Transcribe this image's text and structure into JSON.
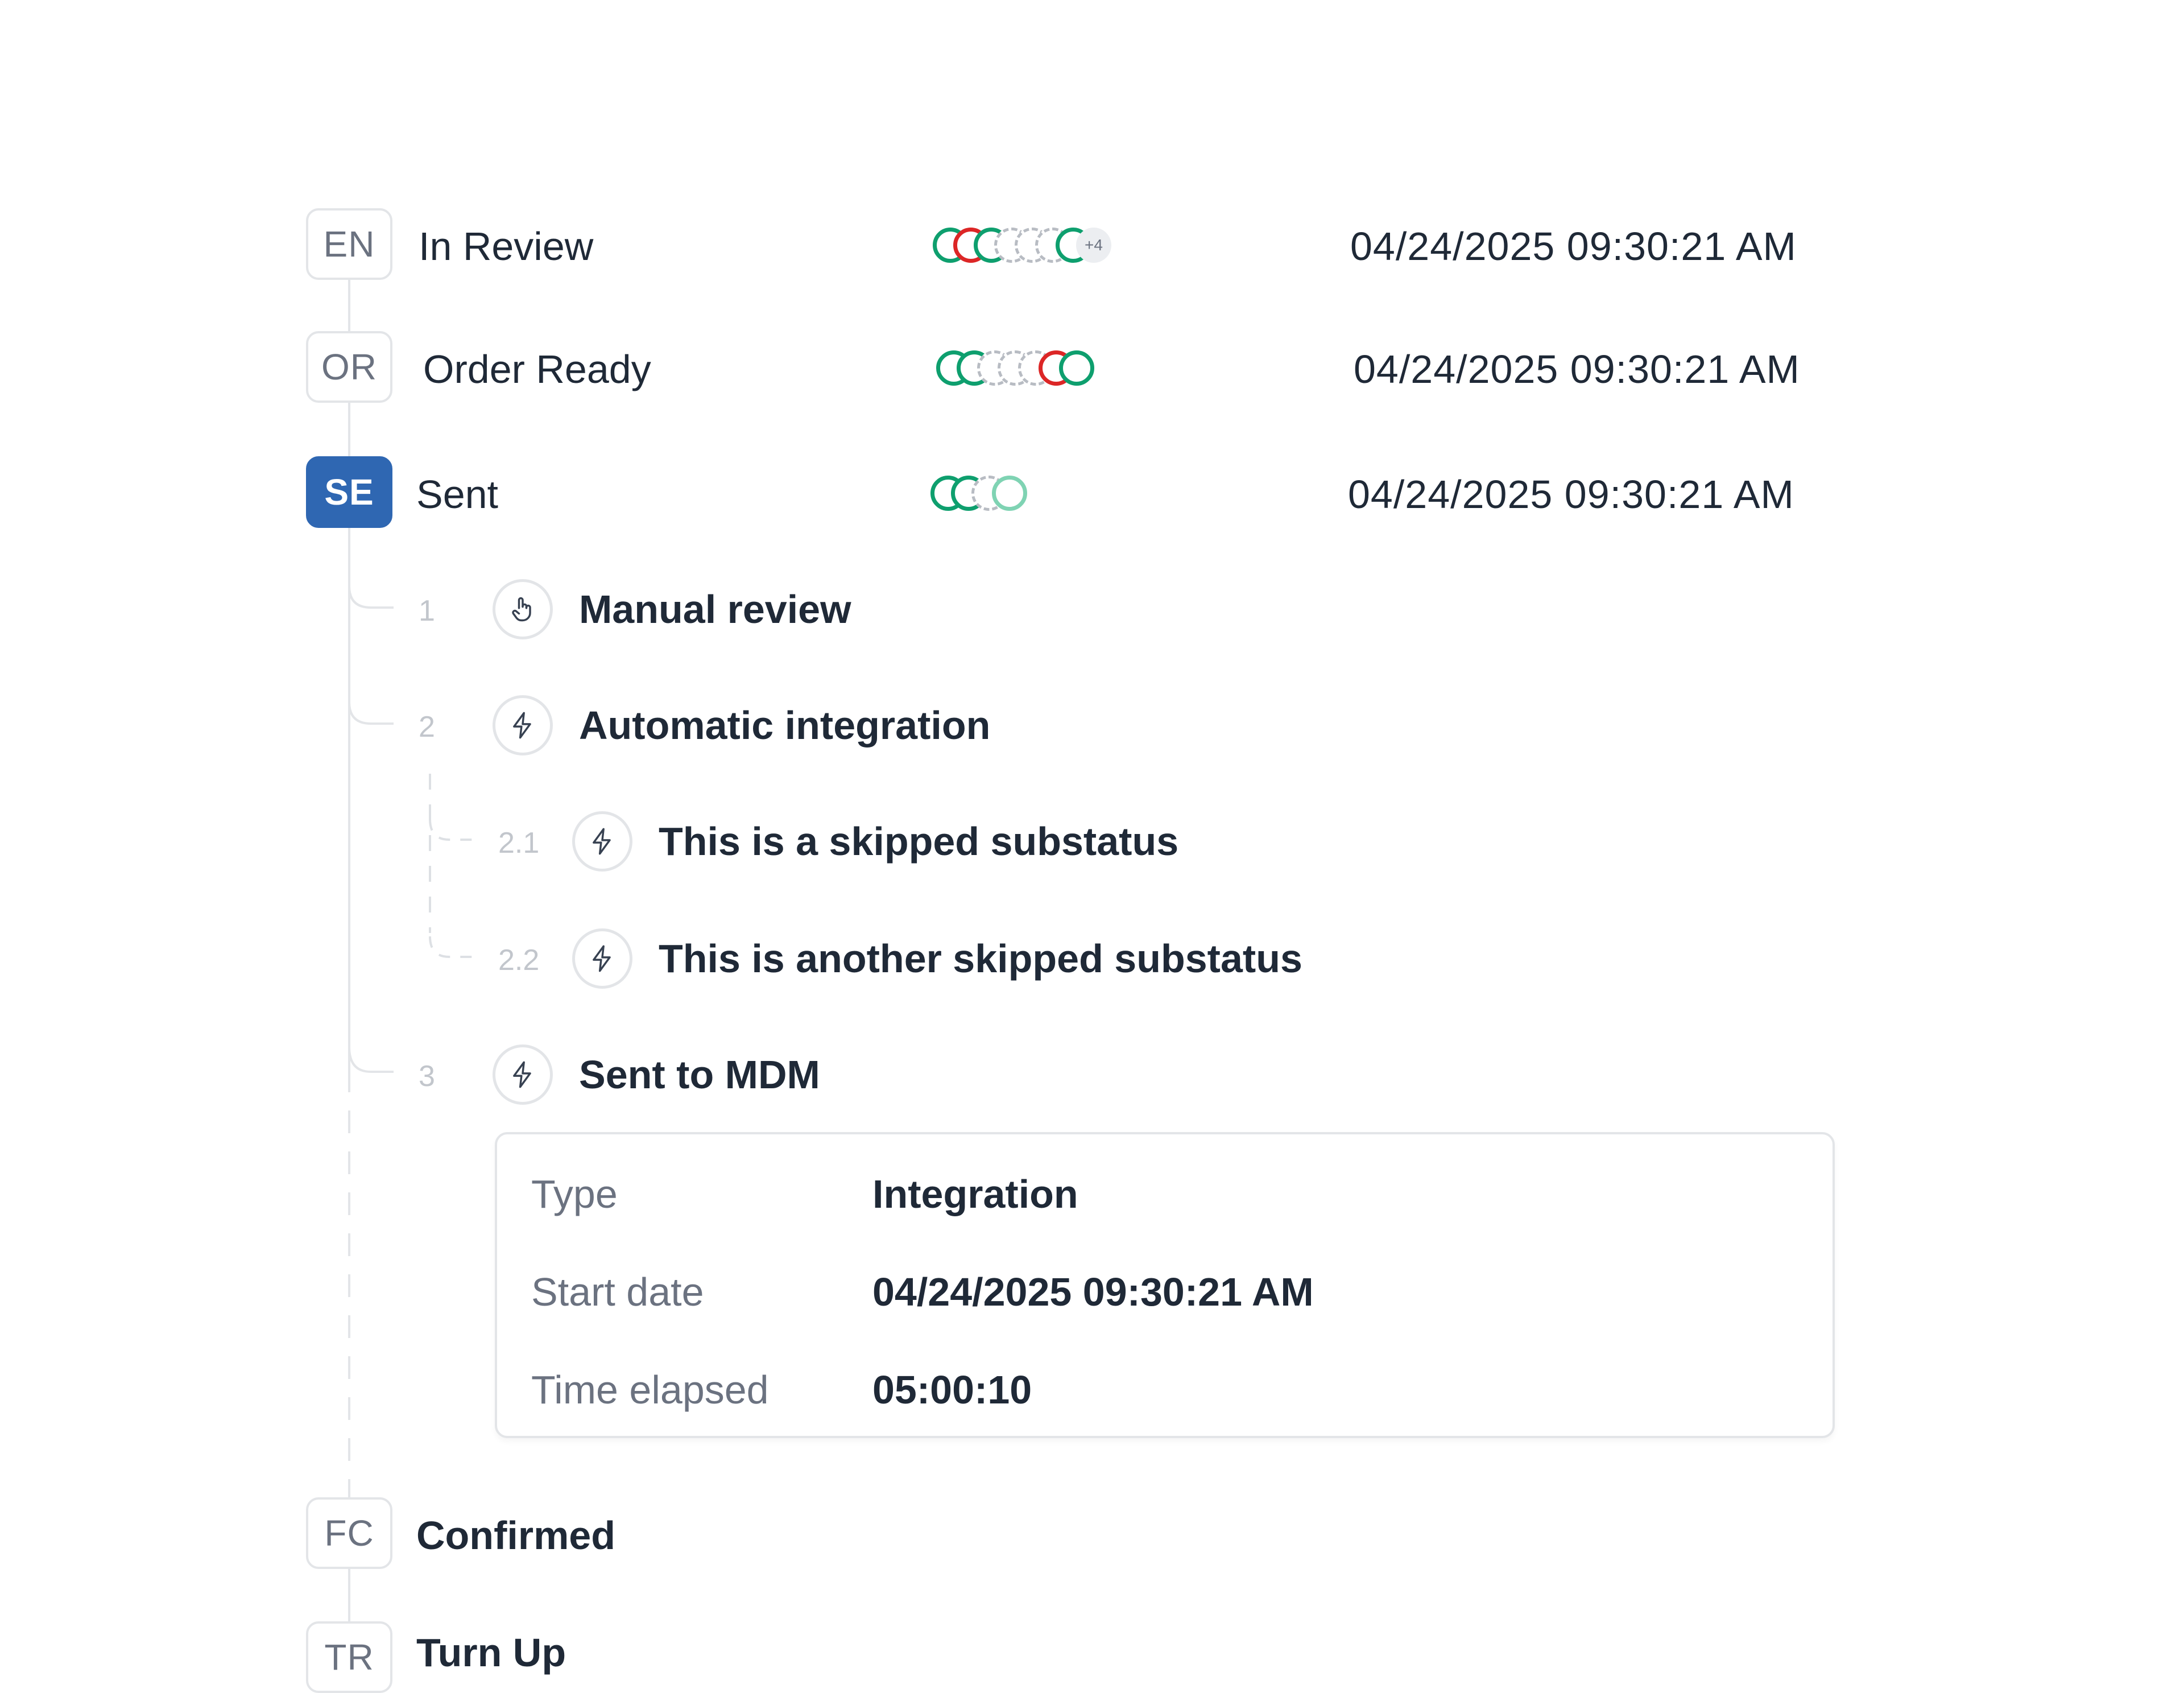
{
  "statuses": [
    {
      "code": "EN",
      "title": "In Review",
      "date": "04/24/2025 09:30:21 AM",
      "more": "+4"
    },
    {
      "code": "OR",
      "title": "Order Ready",
      "date": "04/24/2025 09:30:21 AM"
    },
    {
      "code": "SE",
      "title": "Sent",
      "date": "04/24/2025 09:30:21 AM"
    },
    {
      "code": "FC",
      "title": "Confirmed"
    },
    {
      "code": "TR",
      "title": "Turn Up"
    }
  ],
  "substatuses": [
    {
      "num": "1",
      "title": "Manual review",
      "icon": "hand-pointer-icon"
    },
    {
      "num": "2",
      "title": "Automatic integration",
      "icon": "lightning-icon"
    },
    {
      "num": "2.1",
      "title": "This is a skipped substatus",
      "icon": "lightning-icon"
    },
    {
      "num": "2.2",
      "title": "This is another skipped substatus",
      "icon": "lightning-icon"
    },
    {
      "num": "3",
      "title": "Sent to MDM",
      "icon": "lightning-icon"
    }
  ],
  "details": {
    "type_label": "Type",
    "type_value": "Integration",
    "start_label": "Start date",
    "start_value": "04/24/2025 09:30:21 AM",
    "elapsed_label": "Time elapsed",
    "elapsed_value": "05:00:10"
  },
  "colors": {
    "active": "#2f67b2",
    "success": "#0e9f6e",
    "error": "#dc2626",
    "pending": "#b8bcc3"
  }
}
